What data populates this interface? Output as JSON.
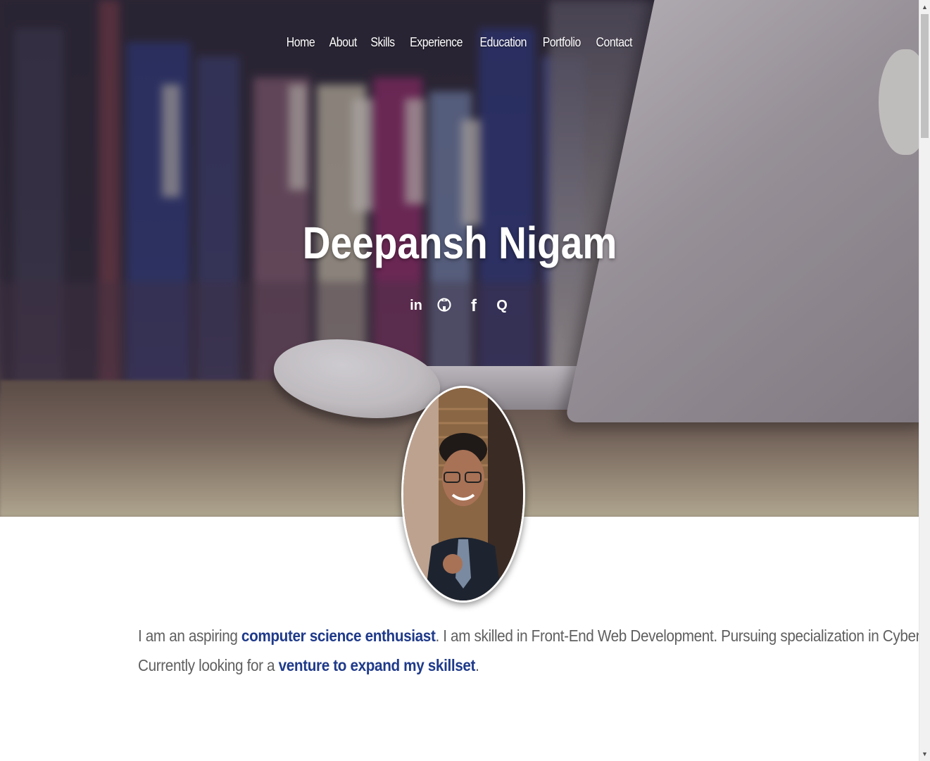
{
  "nav": {
    "items": [
      "Home",
      "About",
      "Skills",
      "Experience",
      "Education",
      "Portfolio",
      "Contact"
    ]
  },
  "hero": {
    "name": "Deepansh Nigam"
  },
  "social": {
    "icons": [
      "linkedin-icon",
      "github-icon",
      "facebook-icon",
      "quora-icon"
    ],
    "labels": [
      "in",
      "",
      "f",
      "Q"
    ]
  },
  "about": {
    "line1": {
      "text1": "I am an aspiring ",
      "highlight1": "computer science enthusiast",
      "text2": ". I am skilled in Front-End Web Development. Pursuing specialization in Cyber Security."
    },
    "line2": {
      "text1": "Currently looking for a ",
      "highlight1": "venture to expand my skillset",
      "text2": "."
    }
  },
  "colors": {
    "highlight": "#1f3a8a",
    "body_text": "#5f5f5f",
    "nav_text": "#ffffff"
  }
}
